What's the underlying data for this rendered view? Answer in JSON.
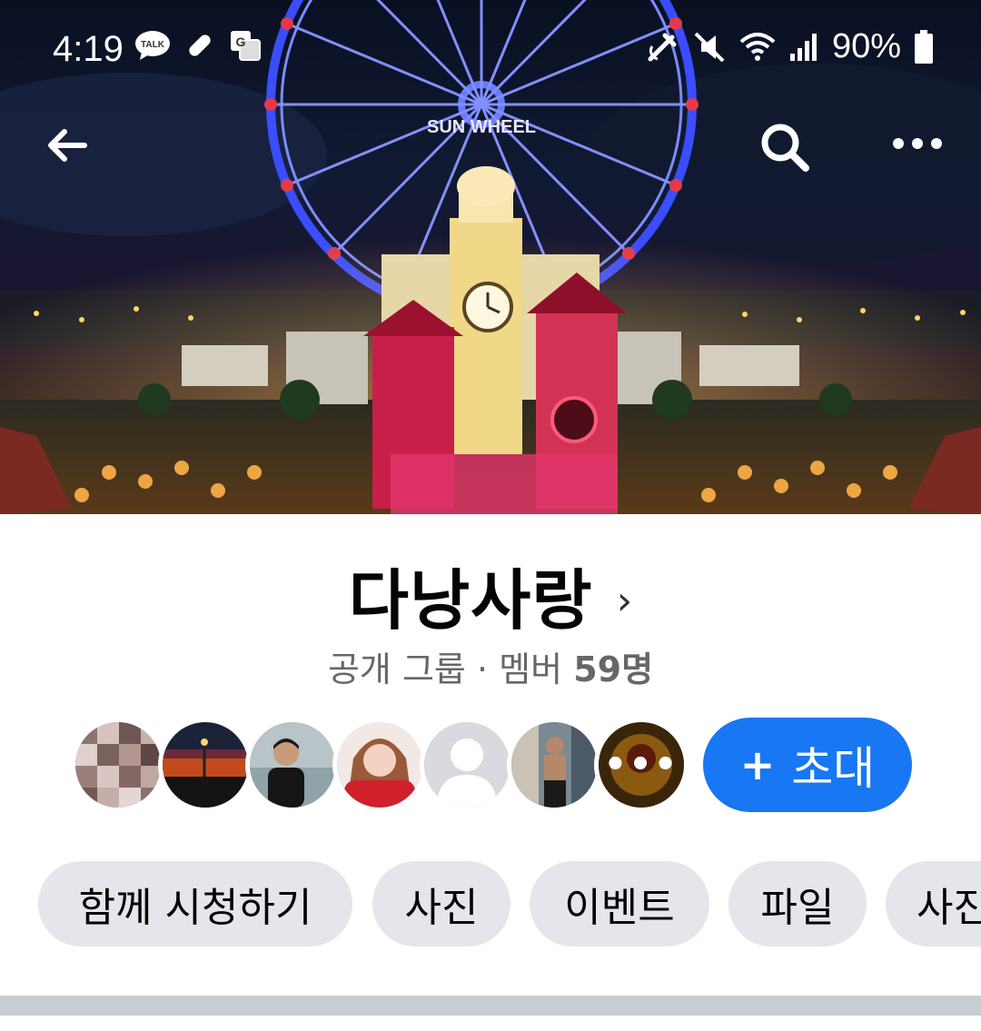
{
  "status_bar": {
    "time": "4:19",
    "left_icons": [
      "kakaotalk-icon",
      "pill-icon",
      "translate-icon"
    ],
    "right_icons": [
      "nfc-icon",
      "mute-icon",
      "wifi-icon",
      "signal-icon",
      "battery-icon"
    ],
    "battery": "90%"
  },
  "cover": {
    "image": "Night view of Sun Wheel ferris wheel and illuminated clock towers",
    "sign_text": "SUN WHEEL"
  },
  "top_bar": {
    "back_icon": "back-arrow-icon",
    "search_icon": "search-icon",
    "more_icon": "more-horizontal-icon"
  },
  "group": {
    "name": "다낭사랑",
    "chevron": "›",
    "privacy": "공개 그룹",
    "separator": "·",
    "members_label": "멤버",
    "members_count": "59명"
  },
  "members": {
    "avatars": [
      "avatar-collage",
      "avatar-sunset",
      "avatar-man-beach",
      "avatar-woman-red",
      "avatar-default",
      "avatar-gym",
      "avatar-more"
    ],
    "more_text": "•••"
  },
  "invite": {
    "plus": "+",
    "label": "초대",
    "color": "#1877f2"
  },
  "chips": [
    {
      "label": "함께 시청하기"
    },
    {
      "label": "사진"
    },
    {
      "label": "이벤트"
    },
    {
      "label": "파일"
    },
    {
      "label": "사진"
    }
  ]
}
